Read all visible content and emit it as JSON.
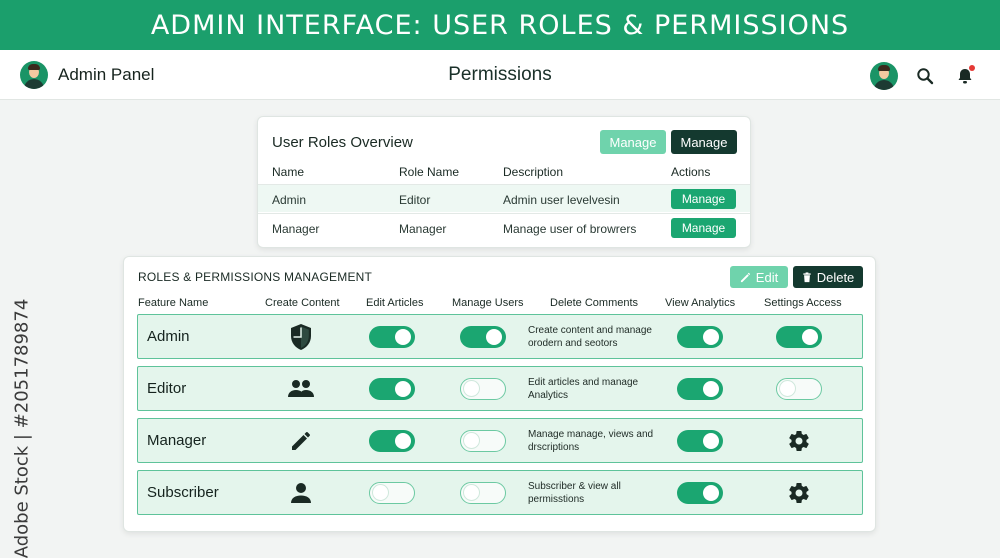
{
  "banner": {
    "title": "ADMIN INTERFACE: USER ROLES & PERMISSIONS"
  },
  "header": {
    "brand": "Admin Panel",
    "page_title": "Permissions",
    "icons": [
      "avatar",
      "search-icon",
      "bell-icon"
    ]
  },
  "overview": {
    "title": "User Roles Overview",
    "buttons": [
      "Manage",
      "Manage"
    ],
    "columns": [
      "Name",
      "Role Name",
      "Description",
      "Actions"
    ],
    "rows": [
      {
        "name": "Admin",
        "role": "Editor",
        "description": "Admin user levelvesin",
        "action": "Manage"
      },
      {
        "name": "Manager",
        "role": "Manager",
        "description": "Manage user of browrers",
        "action": "Manage"
      }
    ]
  },
  "management": {
    "title": "ROLES & PERMISSIONS MANAGEMENT",
    "edit_label": "Edit",
    "delete_label": "Delete",
    "columns": [
      "Feature Name",
      "Create Content",
      "Edit Articles",
      "Manage Users",
      "Delete Comments",
      "View Analytics",
      "Settings Access"
    ],
    "rows": [
      {
        "feature": "Admin",
        "create_icon": "shield-icon",
        "edit_articles": true,
        "manage_users": true,
        "description": "Create content and manage orodern and seotors",
        "view_analytics": true,
        "settings": "toggle",
        "settings_on": true
      },
      {
        "feature": "Editor",
        "create_icon": "users-icon",
        "edit_articles": true,
        "manage_users": false,
        "description": "Edit articles and manage Analytics",
        "view_analytics": true,
        "settings": "toggle",
        "settings_on": false
      },
      {
        "feature": "Manager",
        "create_icon": "pencil-icon",
        "edit_articles": true,
        "manage_users": false,
        "description": "Manage manage, views and drscriptions",
        "view_analytics": true,
        "settings": "gear-icon"
      },
      {
        "feature": "Subscriber",
        "create_icon": "person-icon",
        "edit_articles": false,
        "manage_users": false,
        "description": "Subscriber & view all permisstions",
        "view_analytics": true,
        "settings": "gear-icon"
      }
    ]
  },
  "watermark": {
    "text": "Adobe Stock | #2051789874"
  },
  "colors": {
    "primary": "#1ba671",
    "banner": "#1b9f6c",
    "dark": "#14392f",
    "light": "#6fd3ac",
    "row_bg": "#e4f5ec"
  }
}
